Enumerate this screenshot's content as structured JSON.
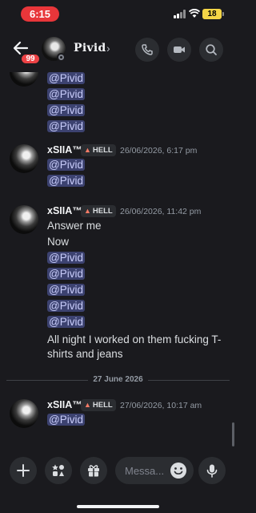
{
  "status_bar": {
    "time": "6:15",
    "battery": "18"
  },
  "header": {
    "unread_badge": "99",
    "channel_name": "Pivid",
    "chevron": "›",
    "icons": [
      "back-arrow-icon",
      "phone-icon",
      "video-icon",
      "search-icon"
    ]
  },
  "messages": [
    {
      "continued": true,
      "lines": [
        "@Pivid",
        "@Pivid",
        "@Pivid",
        "@Pivid"
      ]
    },
    {
      "author": "xSIIA™",
      "tag": "HELL",
      "timestamp": "26/06/2026, 6:17 pm",
      "lines": [
        "@Pivid",
        "@Pivid"
      ]
    },
    {
      "author": "xSIIA™",
      "tag": "HELL",
      "timestamp": "26/06/2026, 11:42 pm",
      "lines": [
        "Answer me",
        "Now",
        "@Pivid",
        "@Pivid",
        "@Pivid",
        "@Pivid",
        "@Pivid",
        "All night I worked on them fucking T-",
        "shirts and jeans"
      ]
    },
    {
      "author": "xSIIA™",
      "tag": "HELL",
      "timestamp": "27/06/2026, 10:17 am",
      "lines": [
        "@Pivid"
      ]
    }
  ],
  "date_divider": "27 June 2026",
  "composer": {
    "placeholder": "Messa...",
    "icons": [
      "plus-icon",
      "apps-icon",
      "gift-icon",
      "emoji-icon",
      "microphone-icon"
    ]
  },
  "colors": {
    "background": "#1a1a1e",
    "mention_bg": "#3c4270",
    "mention_text": "#c9cdfb",
    "status_pill": "#e8363a",
    "unread_badge": "#ed4245",
    "battery": "#f5d547"
  }
}
